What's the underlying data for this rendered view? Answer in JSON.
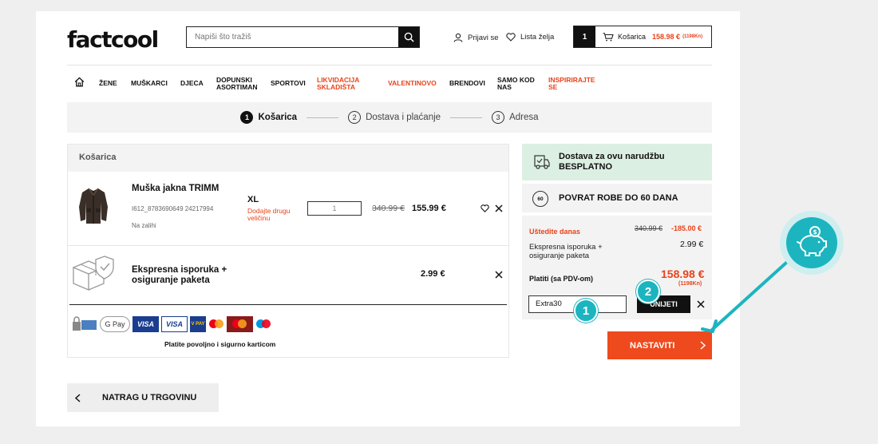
{
  "header": {
    "logo": "factcool",
    "search_placeholder": "Napiši što tražiš",
    "login": "Prijavi se",
    "wishlist": "Lista želja",
    "cart_count": "1",
    "cart_label": "Košarica",
    "cart_price": "158.98 €",
    "cart_kn": "(1198Kn)"
  },
  "nav": [
    {
      "label": "ŽENE",
      "color": "black"
    },
    {
      "label": "MUŠKARCI",
      "color": "black"
    },
    {
      "label": "DJECA",
      "color": "black"
    },
    {
      "label": "DOPUNSKI ASORTIMAN",
      "color": "black"
    },
    {
      "label": "SPORTOVI",
      "color": "black"
    },
    {
      "label": "LIKVIDACIJA SKLADIŠTA",
      "color": "red"
    },
    {
      "label": "VALENTINOVO",
      "color": "red"
    },
    {
      "label": "BRENDOVI",
      "color": "black"
    },
    {
      "label": "SAMO KOD NAS",
      "color": "black"
    },
    {
      "label": "INSPIRIRAJTE SE",
      "color": "red"
    }
  ],
  "steps": [
    {
      "num": "1",
      "label": "Košarica",
      "active": true
    },
    {
      "num": "2",
      "label": "Dostava i plaćanje",
      "active": false
    },
    {
      "num": "3",
      "label": "Adresa",
      "active": false
    }
  ],
  "cart": {
    "heading": "Košarica",
    "product": {
      "name": "Muška jakna TRIMM",
      "sku": "I612_8783690649 24217994",
      "stock": "Na zalihi",
      "size": "XL",
      "other_size": "Dodajte drugu veličinu",
      "qty": "1",
      "old_price": "340.99 €",
      "price": "155.99 €"
    },
    "shipping_item": {
      "name": "Ekspresna isporuka + osiguranje paketa",
      "price": "2.99 €"
    },
    "pay_note": "Platite povoljno i sigurno karticom",
    "payment_logos": [
      "100% secure",
      "G Pay",
      "VISA",
      "VISA",
      "V PAY",
      "Mastercard",
      "Mastercard",
      "Maestro"
    ]
  },
  "summary": {
    "shipping_free": "Dostava za ovu narudžbu BESPLATNO",
    "return": "POVRAT ROBE DO 60 DANA",
    "return_badge": "60",
    "save_label": "Uštedite danas",
    "save_old": "340.99 €",
    "save_amount": "-185.00 €",
    "express_label": "Ekspresna isporuka + osiguranje paketa",
    "express_price": "2.99 €",
    "total_label": "Platiti (sa PDV-om)",
    "total": "158.98 €",
    "total_kn": "(1198Kn)",
    "coupon_value": "Extra30",
    "apply_label": "UNIJETI",
    "continue_label": "NASTAVITI",
    "badge1": "1",
    "badge2": "2"
  },
  "back_label": "NATRAG U TRGOVINU",
  "colors": {
    "accent": "#ee4a1e",
    "teal": "#1cb5bf",
    "green_bg": "#dcefe3"
  }
}
